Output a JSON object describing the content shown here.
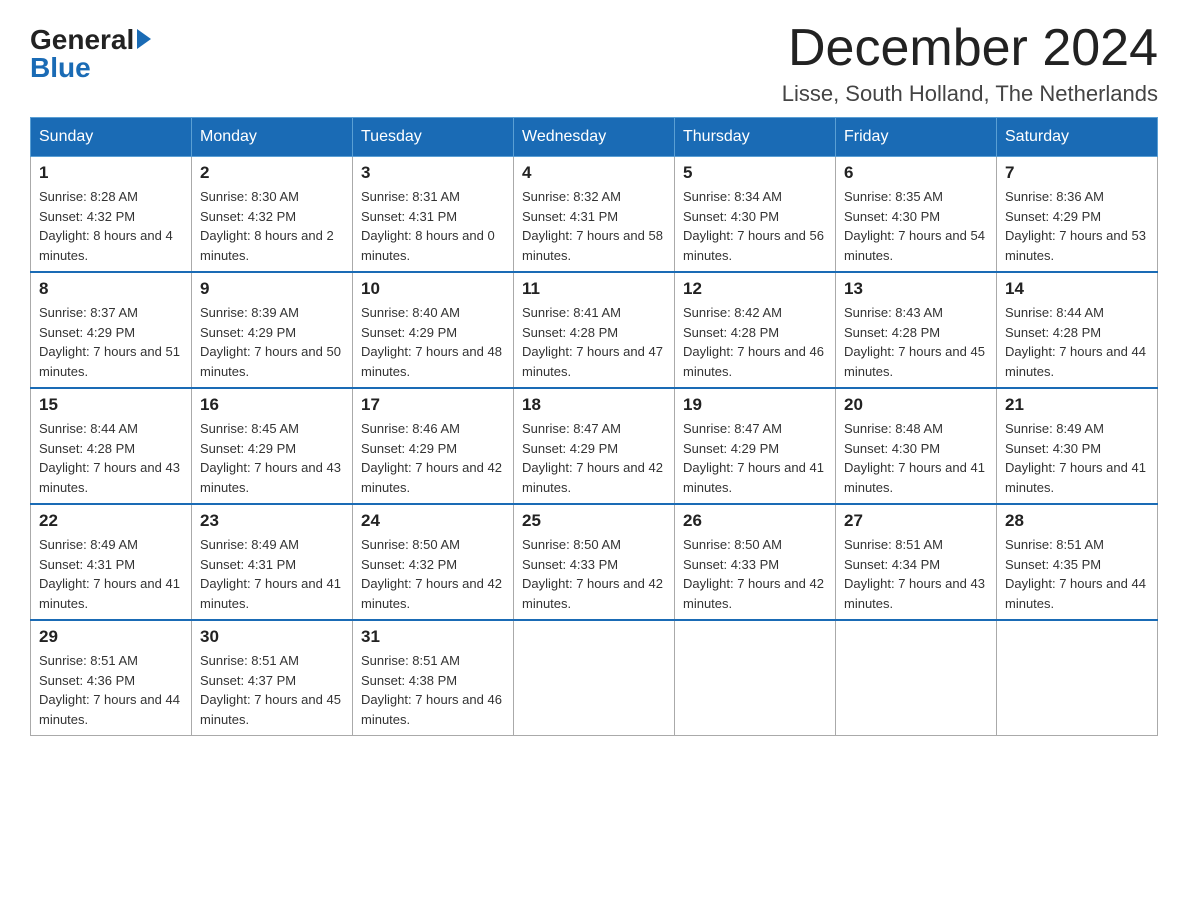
{
  "header": {
    "logo_general": "General",
    "logo_blue": "Blue",
    "title": "December 2024",
    "location": "Lisse, South Holland, The Netherlands"
  },
  "days_of_week": [
    "Sunday",
    "Monday",
    "Tuesday",
    "Wednesday",
    "Thursday",
    "Friday",
    "Saturday"
  ],
  "weeks": [
    [
      {
        "day": "1",
        "sunrise": "8:28 AM",
        "sunset": "4:32 PM",
        "daylight": "8 hours and 4 minutes."
      },
      {
        "day": "2",
        "sunrise": "8:30 AM",
        "sunset": "4:32 PM",
        "daylight": "8 hours and 2 minutes."
      },
      {
        "day": "3",
        "sunrise": "8:31 AM",
        "sunset": "4:31 PM",
        "daylight": "8 hours and 0 minutes."
      },
      {
        "day": "4",
        "sunrise": "8:32 AM",
        "sunset": "4:31 PM",
        "daylight": "7 hours and 58 minutes."
      },
      {
        "day": "5",
        "sunrise": "8:34 AM",
        "sunset": "4:30 PM",
        "daylight": "7 hours and 56 minutes."
      },
      {
        "day": "6",
        "sunrise": "8:35 AM",
        "sunset": "4:30 PM",
        "daylight": "7 hours and 54 minutes."
      },
      {
        "day": "7",
        "sunrise": "8:36 AM",
        "sunset": "4:29 PM",
        "daylight": "7 hours and 53 minutes."
      }
    ],
    [
      {
        "day": "8",
        "sunrise": "8:37 AM",
        "sunset": "4:29 PM",
        "daylight": "7 hours and 51 minutes."
      },
      {
        "day": "9",
        "sunrise": "8:39 AM",
        "sunset": "4:29 PM",
        "daylight": "7 hours and 50 minutes."
      },
      {
        "day": "10",
        "sunrise": "8:40 AM",
        "sunset": "4:29 PM",
        "daylight": "7 hours and 48 minutes."
      },
      {
        "day": "11",
        "sunrise": "8:41 AM",
        "sunset": "4:28 PM",
        "daylight": "7 hours and 47 minutes."
      },
      {
        "day": "12",
        "sunrise": "8:42 AM",
        "sunset": "4:28 PM",
        "daylight": "7 hours and 46 minutes."
      },
      {
        "day": "13",
        "sunrise": "8:43 AM",
        "sunset": "4:28 PM",
        "daylight": "7 hours and 45 minutes."
      },
      {
        "day": "14",
        "sunrise": "8:44 AM",
        "sunset": "4:28 PM",
        "daylight": "7 hours and 44 minutes."
      }
    ],
    [
      {
        "day": "15",
        "sunrise": "8:44 AM",
        "sunset": "4:28 PM",
        "daylight": "7 hours and 43 minutes."
      },
      {
        "day": "16",
        "sunrise": "8:45 AM",
        "sunset": "4:29 PM",
        "daylight": "7 hours and 43 minutes."
      },
      {
        "day": "17",
        "sunrise": "8:46 AM",
        "sunset": "4:29 PM",
        "daylight": "7 hours and 42 minutes."
      },
      {
        "day": "18",
        "sunrise": "8:47 AM",
        "sunset": "4:29 PM",
        "daylight": "7 hours and 42 minutes."
      },
      {
        "day": "19",
        "sunrise": "8:47 AM",
        "sunset": "4:29 PM",
        "daylight": "7 hours and 41 minutes."
      },
      {
        "day": "20",
        "sunrise": "8:48 AM",
        "sunset": "4:30 PM",
        "daylight": "7 hours and 41 minutes."
      },
      {
        "day": "21",
        "sunrise": "8:49 AM",
        "sunset": "4:30 PM",
        "daylight": "7 hours and 41 minutes."
      }
    ],
    [
      {
        "day": "22",
        "sunrise": "8:49 AM",
        "sunset": "4:31 PM",
        "daylight": "7 hours and 41 minutes."
      },
      {
        "day": "23",
        "sunrise": "8:49 AM",
        "sunset": "4:31 PM",
        "daylight": "7 hours and 41 minutes."
      },
      {
        "day": "24",
        "sunrise": "8:50 AM",
        "sunset": "4:32 PM",
        "daylight": "7 hours and 42 minutes."
      },
      {
        "day": "25",
        "sunrise": "8:50 AM",
        "sunset": "4:33 PM",
        "daylight": "7 hours and 42 minutes."
      },
      {
        "day": "26",
        "sunrise": "8:50 AM",
        "sunset": "4:33 PM",
        "daylight": "7 hours and 42 minutes."
      },
      {
        "day": "27",
        "sunrise": "8:51 AM",
        "sunset": "4:34 PM",
        "daylight": "7 hours and 43 minutes."
      },
      {
        "day": "28",
        "sunrise": "8:51 AM",
        "sunset": "4:35 PM",
        "daylight": "7 hours and 44 minutes."
      }
    ],
    [
      {
        "day": "29",
        "sunrise": "8:51 AM",
        "sunset": "4:36 PM",
        "daylight": "7 hours and 44 minutes."
      },
      {
        "day": "30",
        "sunrise": "8:51 AM",
        "sunset": "4:37 PM",
        "daylight": "7 hours and 45 minutes."
      },
      {
        "day": "31",
        "sunrise": "8:51 AM",
        "sunset": "4:38 PM",
        "daylight": "7 hours and 46 minutes."
      },
      null,
      null,
      null,
      null
    ]
  ]
}
